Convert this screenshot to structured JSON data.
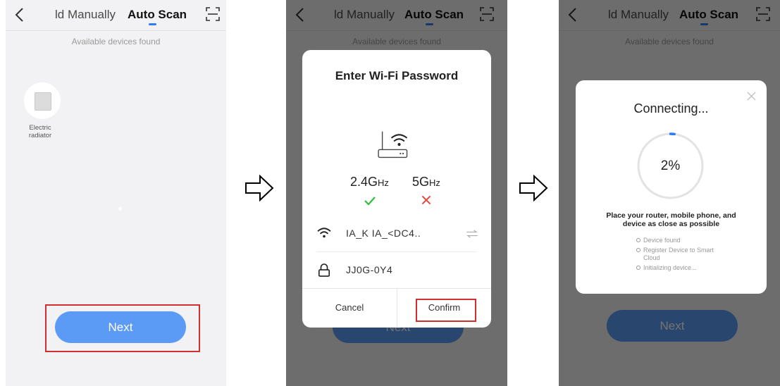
{
  "header": {
    "tab_manual": "ld Manually",
    "tab_auto": "Auto Scan"
  },
  "scan_page": {
    "available_text": "Available devices found",
    "device_name": "Electric radiator",
    "next_label": "Next"
  },
  "wifi_dialog": {
    "title": "Enter Wi-Fi Password",
    "band_24": {
      "main": "2.4G",
      "unit": "Hz",
      "supported": true
    },
    "band_5": {
      "main": "5G",
      "unit": "Hz",
      "supported": false
    },
    "ssid": "IA_K IA_<DC4..",
    "password": "JJ0G-0Y4",
    "cancel_label": "Cancel",
    "confirm_label": "Confirm"
  },
  "connecting_dialog": {
    "title": "Connecting...",
    "progress_text": "2%",
    "progress": 0.02,
    "advice": "Place your router, mobile phone, and device as close as possible",
    "steps": [
      "Device found",
      "Register Device to Smart Cloud",
      "Initializing device..."
    ]
  },
  "colors": {
    "accent": "#2f7df5",
    "button": "#5b9bf5",
    "highlight_box": "#d32f2f",
    "check": "#2fbf3c",
    "cross": "#e8453c"
  }
}
